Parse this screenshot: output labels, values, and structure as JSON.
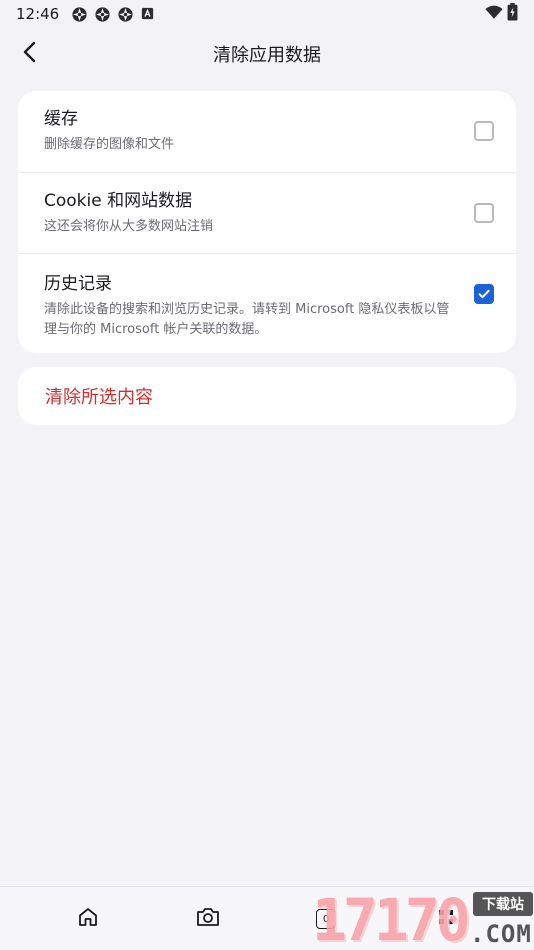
{
  "status_bar": {
    "time": "12:46",
    "left_icons": [
      "camera-aperture-icon",
      "camera-aperture-icon",
      "camera-aperture-icon",
      "keyboard-a-icon"
    ],
    "right_icons": [
      "wifi-icon",
      "battery-charging-icon"
    ]
  },
  "header": {
    "title": "清除应用数据",
    "back_icon": "chevron-left-icon"
  },
  "options": [
    {
      "title": "缓存",
      "description": "删除缓存的图像和文件",
      "checked": false
    },
    {
      "title": "Cookie 和网站数据",
      "description": "这还会将你从大多数网站注销",
      "checked": false
    },
    {
      "title": "历史记录",
      "description": "清除此设备的搜索和浏览历史记录。请转到 Microsoft 隐私仪表板以管理与你的 Microsoft 帐户关联的数据。",
      "checked": true
    }
  ],
  "action": {
    "label": "清除所选内容",
    "color": "#d32f2f"
  },
  "bottom_nav": {
    "items": [
      "home-icon",
      "camera-icon",
      "tabs-icon",
      "apps-icon"
    ],
    "tab_count": "0"
  },
  "watermark": {
    "digits": "17170",
    "badge": "下载站",
    "domain": ".COM"
  },
  "colors": {
    "accent": "#1a62d6",
    "background": "#f2f2f7",
    "card": "#ffffff"
  }
}
